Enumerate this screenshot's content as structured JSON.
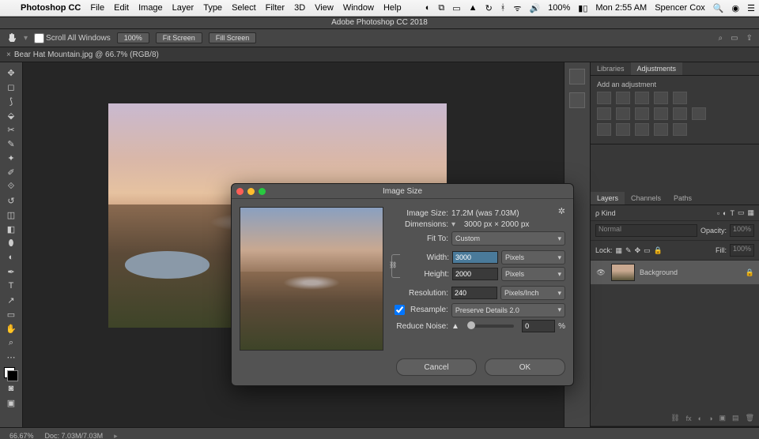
{
  "menubar": {
    "app": "Photoshop CC",
    "items": [
      "File",
      "Edit",
      "Image",
      "Layer",
      "Type",
      "Select",
      "Filter",
      "3D",
      "View",
      "Window",
      "Help"
    ],
    "right": {
      "battery": "100%",
      "clock": "Mon 2:55 AM",
      "user": "Spencer Cox"
    }
  },
  "app_title": "Adobe Photoshop CC 2018",
  "options_bar": {
    "scroll_all": "Scroll All Windows",
    "zoom": "100%",
    "fit": "Fit Screen",
    "fill": "Fill Screen"
  },
  "document_tab": {
    "close": "×",
    "title": "Bear Hat Mountain.jpg @ 66.7% (RGB/8)"
  },
  "right_panels": {
    "top_tabs": [
      "Libraries",
      "Adjustments"
    ],
    "adj_label": "Add an adjustment",
    "layer_tabs": [
      "Layers",
      "Channels",
      "Paths"
    ],
    "kind_label": "ρ Kind",
    "blend": "Normal",
    "opacity_l": "Opacity:",
    "opacity_v": "100%",
    "lock_l": "Lock:",
    "fill_l": "Fill:",
    "fill_v": "100%",
    "layer_name": "Background"
  },
  "dialog": {
    "title": "Image Size",
    "size_l": "Image Size:",
    "size_v": "17.2M (was 7.03M)",
    "dim_l": "Dimensions:",
    "dim_v": "3000 px  ×  2000 px",
    "fit_l": "Fit To:",
    "fit_v": "Custom",
    "w_l": "Width:",
    "w_v": "3000",
    "w_u": "Pixels",
    "h_l": "Height:",
    "h_v": "2000",
    "h_u": "Pixels",
    "res_l": "Resolution:",
    "res_v": "240",
    "res_u": "Pixels/Inch",
    "resample_l": "Resample:",
    "resample_v": "Preserve Details 2.0",
    "noise_l": "Reduce Noise:",
    "noise_v": "0",
    "noise_u": "%",
    "cancel": "Cancel",
    "ok": "OK"
  },
  "status": {
    "zoom": "66.67%",
    "doc": "Doc: 7.03M/7.03M"
  }
}
